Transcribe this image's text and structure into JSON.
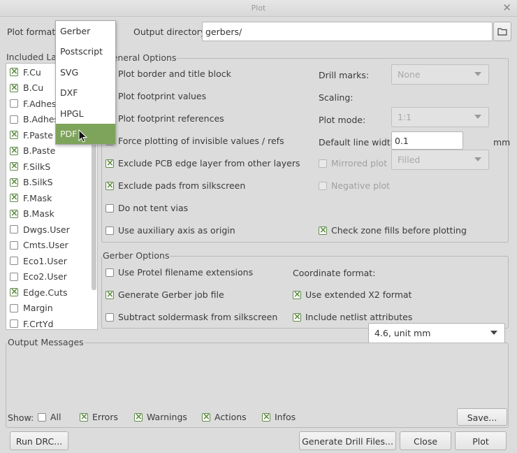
{
  "window": {
    "title": "Plot"
  },
  "top": {
    "plot_format_label": "Plot format:",
    "output_dir_label": "Output directory:",
    "output_dir_value": "gerbers/"
  },
  "dropdown": {
    "items": [
      "Gerber",
      "Postscript",
      "SVG",
      "DXF",
      "HPGL",
      "PDF"
    ],
    "selected": "PDF"
  },
  "layers": {
    "title": "Included Layers",
    "items": [
      {
        "name": "F.Cu",
        "checked": true
      },
      {
        "name": "B.Cu",
        "checked": true
      },
      {
        "name": "F.Adhes",
        "checked": false
      },
      {
        "name": "B.Adhes",
        "checked": false
      },
      {
        "name": "F.Paste",
        "checked": true
      },
      {
        "name": "B.Paste",
        "checked": true
      },
      {
        "name": "F.SilkS",
        "checked": true
      },
      {
        "name": "B.SilkS",
        "checked": true
      },
      {
        "name": "F.Mask",
        "checked": true
      },
      {
        "name": "B.Mask",
        "checked": true
      },
      {
        "name": "Dwgs.User",
        "checked": false
      },
      {
        "name": "Cmts.User",
        "checked": false
      },
      {
        "name": "Eco1.User",
        "checked": false
      },
      {
        "name": "Eco2.User",
        "checked": false
      },
      {
        "name": "Edge.Cuts",
        "checked": true
      },
      {
        "name": "Margin",
        "checked": false
      },
      {
        "name": "F.CrtYd",
        "checked": false
      }
    ]
  },
  "general": {
    "title": "General Options",
    "options": [
      {
        "label": "Plot border and title block",
        "checked": false
      },
      {
        "label": "Plot footprint values",
        "checked": false
      },
      {
        "label": "Plot footprint references",
        "checked": false
      },
      {
        "label": "Force plotting of invisible values / refs",
        "checked": false
      },
      {
        "label": "Exclude PCB edge layer from other layers",
        "checked": true
      },
      {
        "label": "Exclude pads from silkscreen",
        "checked": true
      },
      {
        "label": "Do not tent vias",
        "checked": false
      },
      {
        "label": "Use auxiliary axis as origin",
        "checked": false
      }
    ],
    "drill_marks_label": "Drill marks:",
    "drill_marks_value": "None",
    "scaling_label": "Scaling:",
    "scaling_value": "1:1",
    "plot_mode_label": "Plot mode:",
    "plot_mode_value": "Filled",
    "line_width_label": "Default line width:",
    "line_width_value": "0.1",
    "line_width_unit": "mm",
    "mirrored_label": "Mirrored plot",
    "negative_label": "Negative plot",
    "check_zone_label": "Check zone fills before plotting"
  },
  "gerber": {
    "title": "Gerber Options",
    "protel_label": "Use Protel filename extensions",
    "job_file_label": "Generate Gerber job file",
    "subtract_label": "Subtract soldermask from silkscreen",
    "coord_label": "Coordinate format:",
    "coord_value": "4.6, unit mm",
    "x2_label": "Use extended X2 format",
    "netlist_label": "Include netlist attributes"
  },
  "messages": {
    "title": "Output Messages",
    "show_label": "Show:",
    "filters": [
      "All",
      "Errors",
      "Warnings",
      "Actions",
      "Infos"
    ],
    "save_label": "Save..."
  },
  "buttons": {
    "run_drc": "Run DRC...",
    "drill_files": "Generate Drill Files...",
    "close": "Close",
    "plot": "Plot"
  },
  "colors": {
    "accent": "#7ea35a",
    "background": "#dcdcdc"
  }
}
